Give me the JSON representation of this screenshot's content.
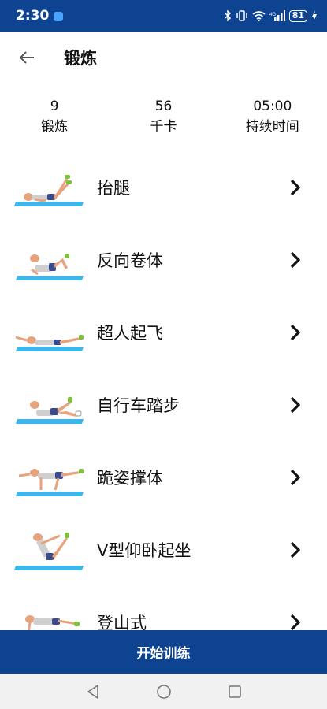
{
  "status_bar": {
    "time": "2:30",
    "battery": "81",
    "icons": [
      "notification-app-icon",
      "bluetooth-icon",
      "vibrate-icon",
      "wifi-icon",
      "signal-icon",
      "battery-icon",
      "charging-icon"
    ]
  },
  "header": {
    "title": "锻炼",
    "back_icon": "arrow-left-icon"
  },
  "stats": [
    {
      "value": "9",
      "label": "锻炼"
    },
    {
      "value": "56",
      "label": "千卡"
    },
    {
      "value": "05:00",
      "label": "持续时间"
    }
  ],
  "exercises": [
    {
      "name": "抬腿",
      "icon": "exercise-thumbnail"
    },
    {
      "name": "反向卷体",
      "icon": "exercise-thumbnail"
    },
    {
      "name": "超人起飞",
      "icon": "exercise-thumbnail"
    },
    {
      "name": "自行车踏步",
      "icon": "exercise-thumbnail"
    },
    {
      "name": "跪姿撑体",
      "icon": "exercise-thumbnail"
    },
    {
      "name": "V型仰卧起坐",
      "icon": "exercise-thumbnail"
    },
    {
      "name": "登山式",
      "icon": "exercise-thumbnail"
    }
  ],
  "start_button": {
    "label": "开始训练"
  },
  "colors": {
    "primary": "#0d4391",
    "mat": "#3fb6e8",
    "skin": "#e7a37c",
    "shorts": "#3b4a8c",
    "shoe": "#7cc23a"
  }
}
